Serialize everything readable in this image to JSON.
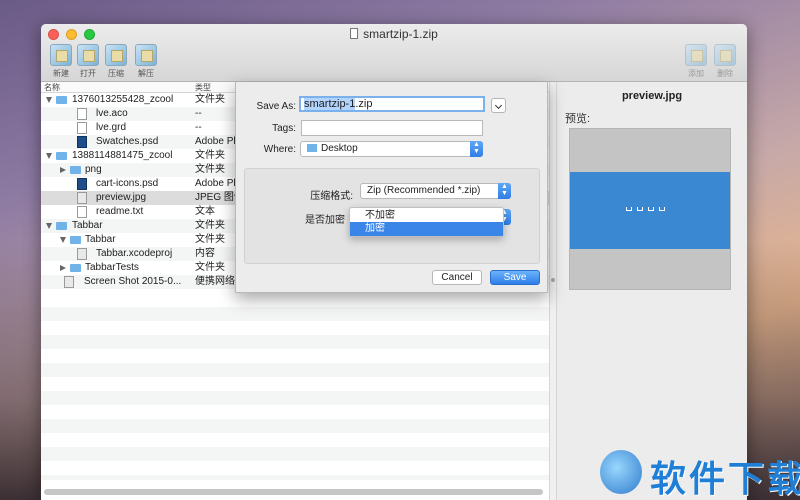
{
  "window": {
    "title": "smartzip-1.zip"
  },
  "toolbar": {
    "left": [
      {
        "label": "新建",
        "icon": "new-archive-icon"
      },
      {
        "label": "打开",
        "icon": "open-archive-icon"
      },
      {
        "label": "压缩",
        "icon": "compress-icon"
      },
      {
        "label": "解压",
        "icon": "extract-icon"
      }
    ],
    "right": [
      {
        "label": "添加",
        "icon": "add-icon"
      },
      {
        "label": "删除",
        "icon": "delete-icon"
      }
    ]
  },
  "file_list": {
    "columns": {
      "name": "名称",
      "kind": "类型"
    },
    "rows": [
      {
        "name": "1376013255428_zcool",
        "kind": "文件夹"
      },
      {
        "name": "lve.aco",
        "kind": "--"
      },
      {
        "name": "lve.grd",
        "kind": "--"
      },
      {
        "name": "Swatches.psd",
        "kind": "Adobe Pl"
      },
      {
        "name": "1388114881475_zcool",
        "kind": "文件夹"
      },
      {
        "name": "png",
        "kind": "文件夹"
      },
      {
        "name": "cart-icons.psd",
        "kind": "Adobe Pl"
      },
      {
        "name": "preview.jpg",
        "kind": "JPEG 图像"
      },
      {
        "name": "readme.txt",
        "kind": "文本"
      },
      {
        "name": "Tabbar",
        "kind": "文件夹"
      },
      {
        "name": "Tabbar",
        "kind": "文件夹"
      },
      {
        "name": "Tabbar.xcodeproj",
        "kind": "内容"
      },
      {
        "name": "TabbarTests",
        "kind": "文件夹"
      },
      {
        "name": "Screen Shot 2015-0...",
        "kind": "便携网络图"
      }
    ]
  },
  "preview_pane": {
    "title": "preview.jpg",
    "label": "预览:"
  },
  "save_dialog": {
    "save_as_label": "Save As:",
    "save_as_selected": "smartzip-1",
    "save_as_ext": ".zip",
    "tags_label": "Tags:",
    "tags_value": "",
    "where_label": "Where:",
    "where_value": "Desktop",
    "format_label": "压缩格式:",
    "format_value": "Zip (Recommended *.zip)",
    "encrypt_label": "是否加密",
    "encrypt_options": [
      "不加密",
      "加密"
    ],
    "cancel_label": "Cancel",
    "save_label": "Save"
  },
  "watermark": {
    "text": "软件下载"
  },
  "colors": {
    "accent": "#3a85e8",
    "folder": "#6fb3e8"
  }
}
